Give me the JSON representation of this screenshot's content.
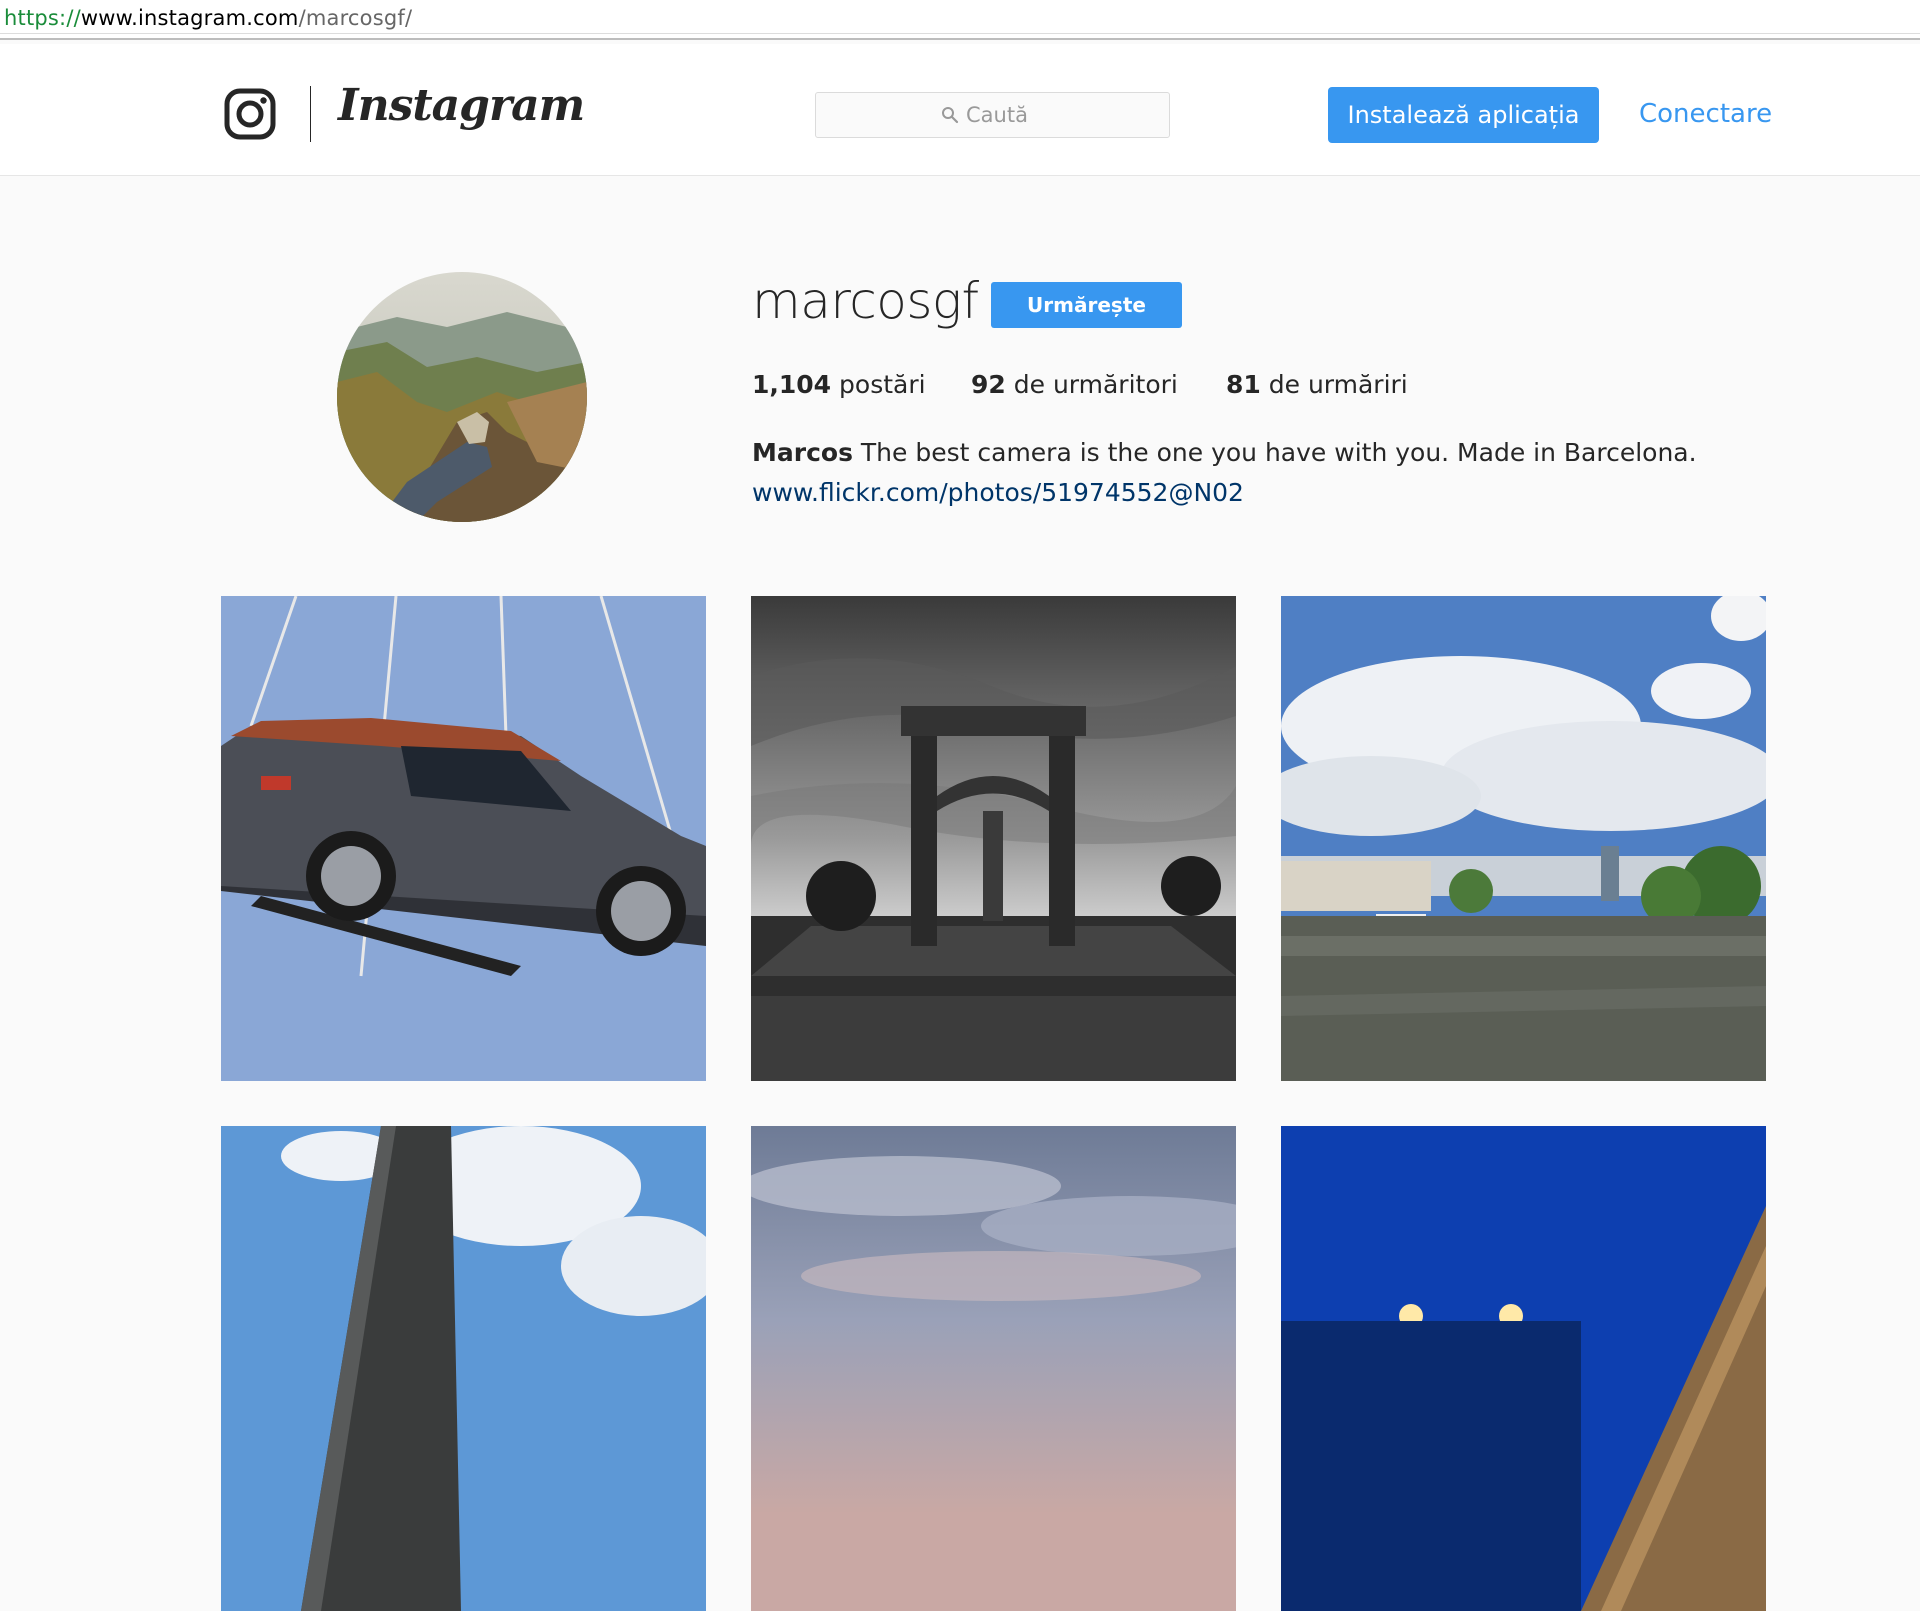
{
  "browser": {
    "url_scheme": "https://",
    "url_host": "www.instagram.com",
    "url_path": "/marcosgf/"
  },
  "header": {
    "brand": "Instagram",
    "search_placeholder": "Caută",
    "install_label": "Instalează aplicația",
    "login_label": "Conectare"
  },
  "profile": {
    "username": "marcosgf",
    "follow_label": "Urmărește",
    "stats": [
      {
        "value": "1,104",
        "label": "postări"
      },
      {
        "value": "92",
        "label": "de urmăritori"
      },
      {
        "value": "81",
        "label": "de urmăriri"
      }
    ],
    "bio_name": "Marcos",
    "bio_text": "The best camera is the one you have with you. Made in Barcelona.",
    "bio_link": "www.flickr.com/photos/51974552@N02"
  },
  "colors": {
    "accent": "#3897f0",
    "text": "#262626",
    "link": "#003569",
    "background": "#fafafa"
  },
  "icons": [
    "instagram-glyph-icon",
    "search-icon"
  ]
}
